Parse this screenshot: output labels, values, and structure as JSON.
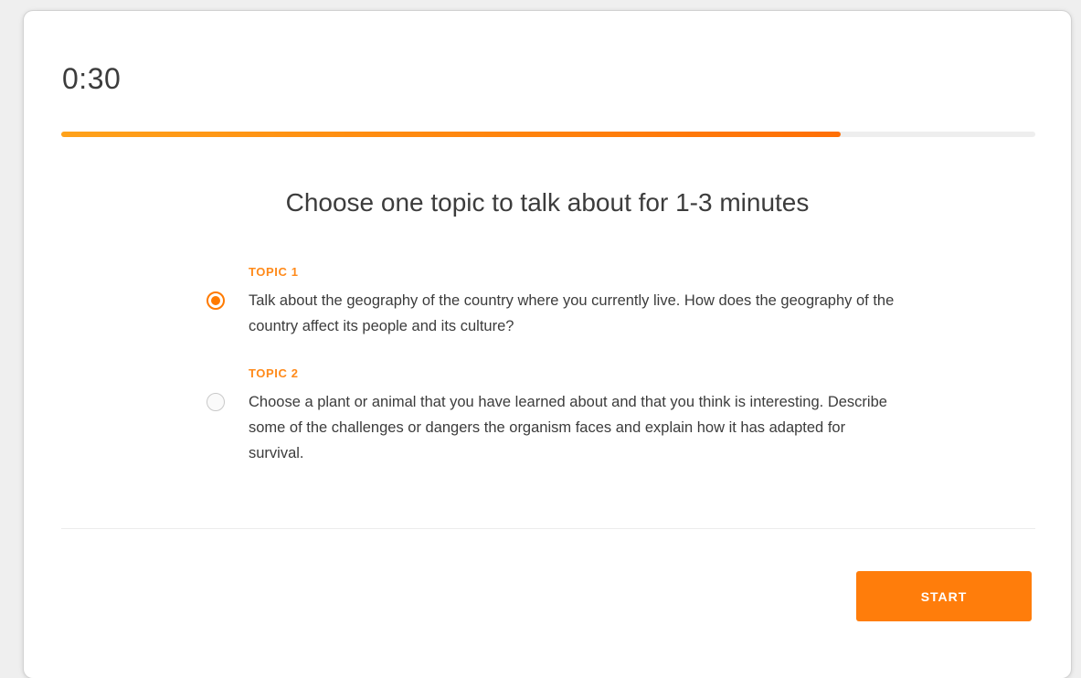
{
  "timer": "0:30",
  "progress": {
    "fraction": 0.8
  },
  "prompt": {
    "heading": "Choose one topic to talk about for 1-3 minutes"
  },
  "topics": [
    {
      "label": "TOPIC 1",
      "text": "Talk about the geography of the country where you currently live. How does the geography of the country affect its people and its culture?",
      "selected": true
    },
    {
      "label": "TOPIC 2",
      "text": "Choose a plant or animal that you have learned about and that you think is interesting. Describe some of the challenges or dangers the organism faces and explain how it has adapted for survival.",
      "selected": false
    }
  ],
  "actions": {
    "start_label": "START"
  },
  "colors": {
    "accent": "#ff7d0b",
    "progress_start": "#ffa21a",
    "progress_end": "#ff6f05",
    "topic_label": "#ff8a1a",
    "text": "#3c3c3c"
  }
}
